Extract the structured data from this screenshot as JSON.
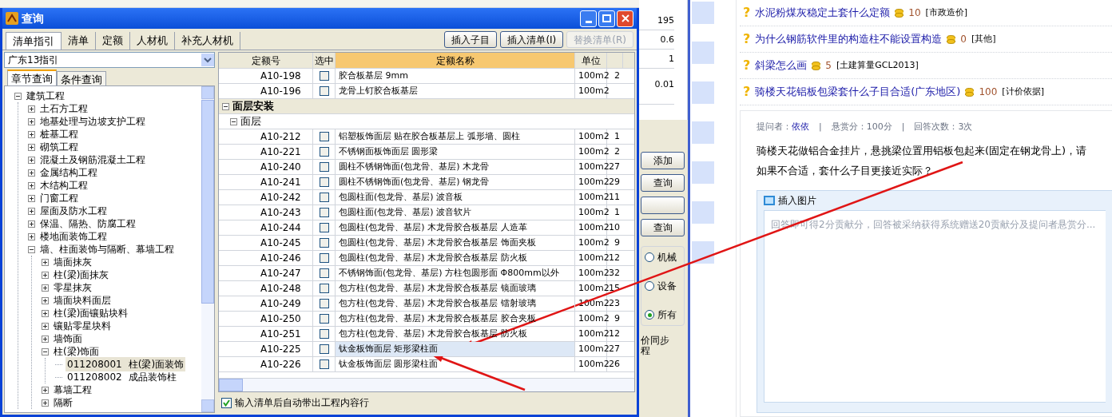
{
  "dialog": {
    "title": "查询",
    "tabs": [
      {
        "label": "清单指引",
        "selected": true
      },
      {
        "label": "清单",
        "selected": false
      },
      {
        "label": "定额",
        "selected": false
      },
      {
        "label": "人材机",
        "selected": false
      },
      {
        "label": "补充人材机",
        "selected": false
      }
    ],
    "toolbar_buttons": [
      {
        "label": "插入子目",
        "disabled": false
      },
      {
        "label": "插入清单(I)",
        "disabled": false
      },
      {
        "label": "替换清单(R)",
        "disabled": true
      }
    ],
    "guide_select": {
      "value": "广东13指引"
    },
    "sub_tabs": [
      {
        "label": "章节查询",
        "selected": true
      },
      {
        "label": "条件查询",
        "selected": false
      }
    ],
    "tree": [
      {
        "label": "建筑工程",
        "expanded": true,
        "selected": false,
        "children": [
          {
            "label": "土石方工程",
            "expanded": false,
            "selected": false
          },
          {
            "label": "地基处理与边坡支护工程",
            "expanded": false,
            "selected": false
          },
          {
            "label": "桩基工程",
            "expanded": false,
            "selected": false
          },
          {
            "label": "砌筑工程",
            "expanded": false,
            "selected": false
          },
          {
            "label": "混凝土及钢筋混凝土工程",
            "expanded": false,
            "selected": false
          },
          {
            "label": "金属结构工程",
            "expanded": false,
            "selected": false
          },
          {
            "label": "木结构工程",
            "expanded": false,
            "selected": false
          },
          {
            "label": "门窗工程",
            "expanded": false,
            "selected": false
          },
          {
            "label": "屋面及防水工程",
            "expanded": false,
            "selected": false
          },
          {
            "label": "保温、隔热、防腐工程",
            "expanded": false,
            "selected": false
          },
          {
            "label": "楼地面装饰工程",
            "expanded": false,
            "selected": false
          },
          {
            "label": "墙、柱面装饰与隔断、幕墙工程",
            "expanded": true,
            "selected": false,
            "children": [
              {
                "label": "墙面抹灰",
                "expanded": false,
                "selected": false
              },
              {
                "label": "柱(梁)面抹灰",
                "expanded": false,
                "selected": false
              },
              {
                "label": "零星抹灰",
                "expanded": false,
                "selected": false
              },
              {
                "label": "墙面块料面层",
                "expanded": false,
                "selected": false
              },
              {
                "label": "柱(梁)面镶贴块料",
                "expanded": false,
                "selected": false
              },
              {
                "label": "镶贴零星块料",
                "expanded": false,
                "selected": false
              },
              {
                "label": "墙饰面",
                "expanded": false,
                "selected": false
              },
              {
                "label": "柱(梁)饰面",
                "expanded": true,
                "selected": false,
                "children": [
                  {
                    "kind": "leaf",
                    "code": "011208001",
                    "label": "柱(梁)面装饰",
                    "selected": true
                  },
                  {
                    "kind": "leaf",
                    "code": "011208002",
                    "label": "成品装饰柱",
                    "selected": false
                  }
                ]
              },
              {
                "label": "幕墙工程",
                "expanded": false,
                "selected": false
              },
              {
                "label": "隔断",
                "expanded": false,
                "selected": false
              }
            ]
          }
        ]
      }
    ],
    "table": {
      "columns": [
        "定额号",
        "选中",
        "定额名称",
        "单位",
        ""
      ],
      "rows": [
        {
          "kind": "item",
          "code": "A10-198",
          "checked": false,
          "name": "胶合板基层 9mm",
          "unit": "100m2",
          "column_5": "2",
          "selected": false
        },
        {
          "kind": "item",
          "code": "A10-196",
          "checked": false,
          "name": "龙骨上钉胶合板基层",
          "unit": "100m2",
          "column_5": "",
          "selected": false
        },
        {
          "kind": "group",
          "name": "面层安装",
          "expanded": true
        },
        {
          "kind": "subgroup",
          "name": "面层",
          "expanded": true
        },
        {
          "kind": "item",
          "code": "A10-212",
          "checked": false,
          "name": "铝塑板饰面层 贴在胶合板基层上 弧形墙、圆柱",
          "unit": "100m2",
          "column_5": "1",
          "selected": false
        },
        {
          "kind": "item",
          "code": "A10-221",
          "checked": false,
          "name": "不锈钢面板饰面层 圆形梁",
          "unit": "100m2",
          "column_5": "2",
          "selected": false
        },
        {
          "kind": "item",
          "code": "A10-240",
          "checked": false,
          "name": "圆柱不锈钢饰面(包龙骨、基层) 木龙骨",
          "unit": "100m2",
          "column_5": "27",
          "selected": false
        },
        {
          "kind": "item",
          "code": "A10-241",
          "checked": false,
          "name": "圆柱不锈钢饰面(包龙骨、基层) 钢龙骨",
          "unit": "100m2",
          "column_5": "29",
          "selected": false
        },
        {
          "kind": "item",
          "code": "A10-242",
          "checked": false,
          "name": "包圆柱面(包龙骨、基层) 波音板",
          "unit": "100m2",
          "column_5": "11",
          "selected": false
        },
        {
          "kind": "item",
          "code": "A10-243",
          "checked": false,
          "name": "包圆柱面(包龙骨、基层) 波音软片",
          "unit": "100m2",
          "column_5": "1",
          "selected": false
        },
        {
          "kind": "item",
          "code": "A10-244",
          "checked": false,
          "name": "包圆柱(包龙骨、基层) 木龙骨胶合板基层 人造革",
          "unit": "100m2",
          "column_5": "10",
          "selected": false
        },
        {
          "kind": "item",
          "code": "A10-245",
          "checked": false,
          "name": "包圆柱(包龙骨、基层) 木龙骨胶合板基层 饰面夹板",
          "unit": "100m2",
          "column_5": "9",
          "selected": false
        },
        {
          "kind": "item",
          "code": "A10-246",
          "checked": false,
          "name": "包圆柱(包龙骨、基层) 木龙骨胶合板基层 防火板",
          "unit": "100m2",
          "column_5": "12",
          "selected": false
        },
        {
          "kind": "item",
          "code": "A10-247",
          "checked": false,
          "name": "不锈钢饰面(包龙骨、基层) 方柱包圆形面 Φ800mm以外",
          "unit": "100m2",
          "column_5": "32",
          "selected": false
        },
        {
          "kind": "item",
          "code": "A10-248",
          "checked": false,
          "name": "包方柱(包龙骨、基层) 木龙骨胶合板基层 镜面玻璃",
          "unit": "100m2",
          "column_5": "15",
          "selected": false
        },
        {
          "kind": "item",
          "code": "A10-249",
          "checked": false,
          "name": "包方柱(包龙骨、基层) 木龙骨胶合板基层 镭射玻璃",
          "unit": "100m2",
          "column_5": "23",
          "selected": false
        },
        {
          "kind": "item",
          "code": "A10-250",
          "checked": false,
          "name": "包方柱(包龙骨、基层) 木龙骨胶合板基层 胶合夹板",
          "unit": "100m2",
          "column_5": "9",
          "selected": false
        },
        {
          "kind": "item",
          "code": "A10-251",
          "checked": false,
          "name": "包方柱(包龙骨、基层) 木龙骨胶合板基层 防火板",
          "unit": "100m2",
          "column_5": "12",
          "selected": false
        },
        {
          "kind": "item",
          "code": "A10-225",
          "checked": false,
          "name": "钛金板饰面层 矩形梁柱面",
          "unit": "100m2",
          "column_5": "27",
          "selected": true
        },
        {
          "kind": "item",
          "code": "A10-226",
          "checked": false,
          "name": "钛金板饰面层 圆形梁柱面",
          "unit": "100m2",
          "column_5": "26",
          "selected": false
        }
      ]
    },
    "auto_content": {
      "label": "输入清单后自动带出工程内容行",
      "checked": true
    }
  },
  "back_window": {
    "cells": [
      "195",
      "0.6",
      "1",
      "0.01"
    ],
    "buttons": [
      {
        "kind": "text",
        "label": "添加"
      },
      {
        "kind": "text",
        "label": "查询"
      },
      {
        "kind": "blank"
      },
      {
        "kind": "text",
        "label": "查询"
      }
    ],
    "radios": [
      {
        "label": "机械",
        "selected": false
      },
      {
        "label": "设备",
        "selected": false
      },
      {
        "label": "所有",
        "selected": true
      }
    ],
    "note_lines": [
      "价同步",
      "程"
    ]
  },
  "questions": [
    {
      "icon": "?",
      "title": "水泥粉煤灰稳定土套什么定额",
      "points": "10",
      "category": "[市政造价]"
    },
    {
      "icon": "?",
      "title": "为什么钢筋软件里的构造柱不能设置构造",
      "points": "0",
      "category": "[其他]"
    },
    {
      "icon": "?",
      "title": "斜梁怎么画",
      "points": "5",
      "category": "[土建算量GCL2013]"
    },
    {
      "icon": "?",
      "title": "骑楼天花铝板包梁套什么子目合适(广东地区)",
      "points": "100",
      "category": "[计价依据]"
    }
  ],
  "question_detail": {
    "asker_label": "提问者：",
    "asker": "依依",
    "separators": [
      "|",
      "|"
    ],
    "reward": "悬赏分：100分",
    "answers": "回答次数：3次",
    "body": [
      "骑楼天花做铝合金挂片，悬挑梁位置用铝板包起来(固定在钢龙骨上)，请",
      "如果不合适，套什么子目更接近实际？"
    ],
    "editor": {
      "insert_image": "插入图片",
      "placeholder": "回答即可得2分贡献分，回答被采纳获得系统赠送20贡献分及提问者悬赏分..."
    }
  }
}
